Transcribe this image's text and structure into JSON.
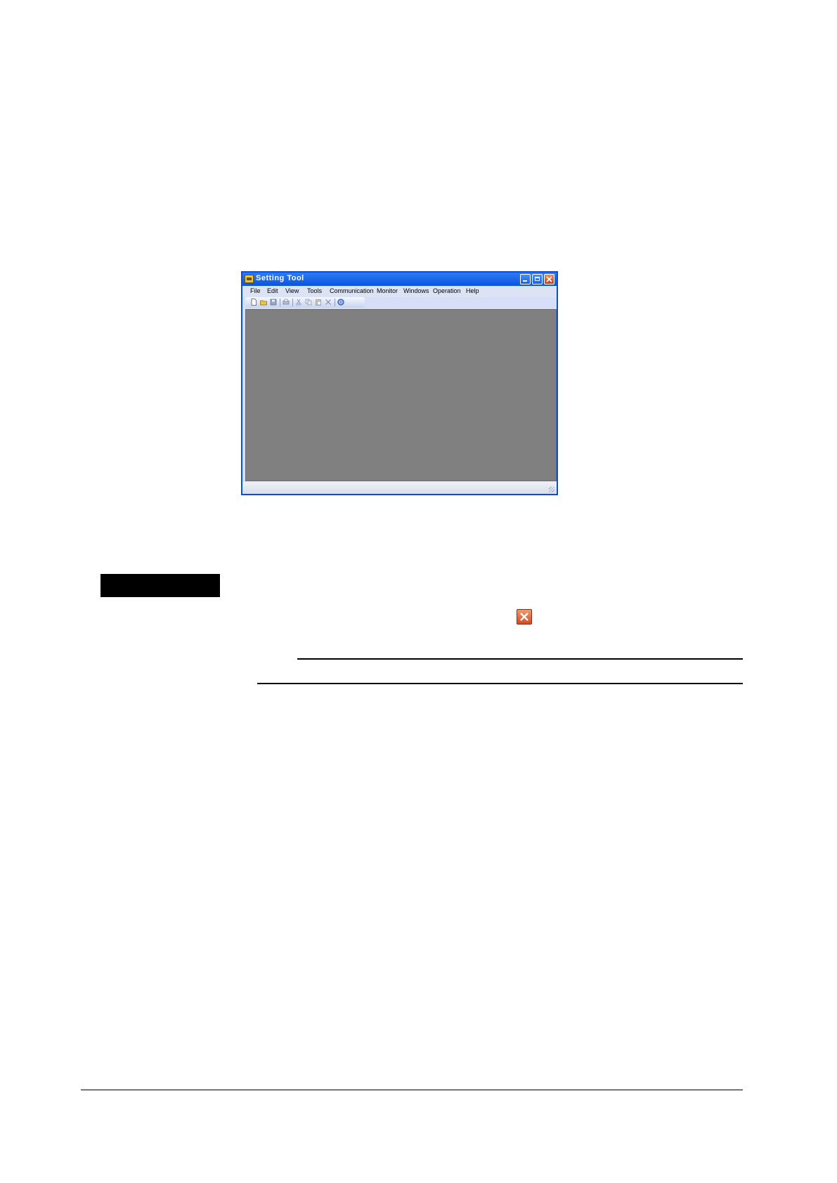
{
  "window": {
    "title": "Setting Tool",
    "menu": [
      "File",
      "Edit",
      "View",
      "Tools",
      "Communication",
      "Monitor",
      "Windows",
      "Operation",
      "Help"
    ]
  },
  "toolbar": {
    "icons": [
      "new-file-icon",
      "open-folder-icon",
      "save-icon",
      "print-icon",
      "cut-icon",
      "copy-icon",
      "paste-icon",
      "delete-icon",
      "help-icon"
    ]
  },
  "colors": {
    "titlebar": "#0a54e0",
    "client_area": "#808080",
    "close_button": "#d44a22"
  }
}
